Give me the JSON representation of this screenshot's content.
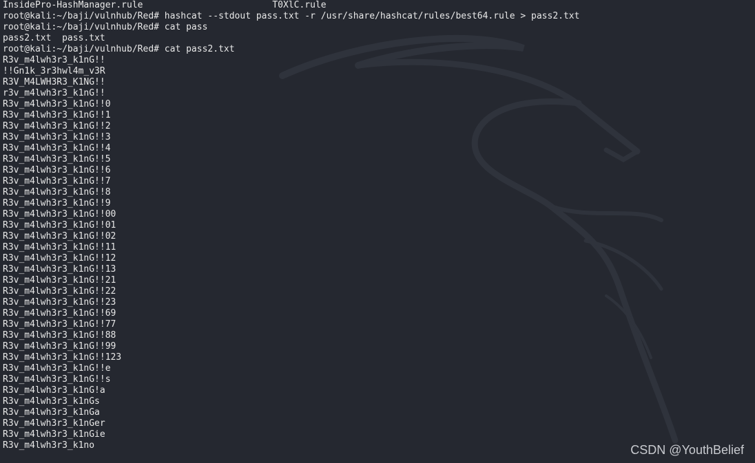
{
  "terminal": {
    "lines": [
      "InsidePro-HashManager.rule                        T0XlC.rule",
      "root@kali:~/baji/vulnhub/Red# hashcat --stdout pass.txt -r /usr/share/hashcat/rules/best64.rule > pass2.txt",
      "root@kali:~/baji/vulnhub/Red# cat pass",
      "pass2.txt  pass.txt",
      "root@kali:~/baji/vulnhub/Red# cat pass2.txt",
      "R3v_m4lwh3r3_k1nG!!",
      "!!Gn1k_3r3hwl4m_v3R",
      "R3V_M4LWH3R3_K1NG!!",
      "r3v_m4lwh3r3_k1nG!!",
      "R3v_m4lwh3r3_k1nG!!0",
      "R3v_m4lwh3r3_k1nG!!1",
      "R3v_m4lwh3r3_k1nG!!2",
      "R3v_m4lwh3r3_k1nG!!3",
      "R3v_m4lwh3r3_k1nG!!4",
      "R3v_m4lwh3r3_k1nG!!5",
      "R3v_m4lwh3r3_k1nG!!6",
      "R3v_m4lwh3r3_k1nG!!7",
      "R3v_m4lwh3r3_k1nG!!8",
      "R3v_m4lwh3r3_k1nG!!9",
      "R3v_m4lwh3r3_k1nG!!00",
      "R3v_m4lwh3r3_k1nG!!01",
      "R3v_m4lwh3r3_k1nG!!02",
      "R3v_m4lwh3r3_k1nG!!11",
      "R3v_m4lwh3r3_k1nG!!12",
      "R3v_m4lwh3r3_k1nG!!13",
      "R3v_m4lwh3r3_k1nG!!21",
      "R3v_m4lwh3r3_k1nG!!22",
      "R3v_m4lwh3r3_k1nG!!23",
      "R3v_m4lwh3r3_k1nG!!69",
      "R3v_m4lwh3r3_k1nG!!77",
      "R3v_m4lwh3r3_k1nG!!88",
      "R3v_m4lwh3r3_k1nG!!99",
      "R3v_m4lwh3r3_k1nG!!123",
      "R3v_m4lwh3r3_k1nG!!e",
      "R3v_m4lwh3r3_k1nG!!s",
      "R3v_m4lwh3r3_k1nG!a",
      "R3v_m4lwh3r3_k1nGs",
      "R3v_m4lwh3r3_k1nGa",
      "R3v_m4lwh3r3_k1nGer",
      "R3v_m4lwh3r3_k1nGie",
      "R3v_m4lwh3r3_k1no"
    ]
  },
  "watermark": "CSDN @YouthBelief",
  "colors": {
    "background": "#252830",
    "text": "#e8e8e8",
    "dragon": "#2e323b"
  }
}
